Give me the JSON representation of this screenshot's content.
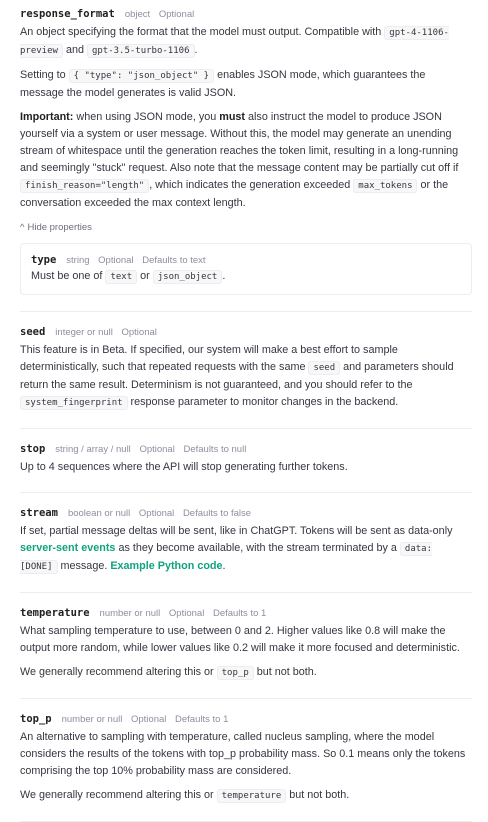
{
  "params": {
    "response_format": {
      "name": "response_format",
      "type": "object",
      "optional": "Optional",
      "d1_a": "An object specifying the format that the model must output. Compatible with",
      "d1_code1": "gpt-4-1106-preview",
      "d1_and": "and",
      "d1_code2": "gpt-3.5-turbo-1106",
      "d1_end": ".",
      "d2_a": "Setting to",
      "d2_code": "{ \"type\": \"json_object\" }",
      "d2_b": "enables JSON mode, which guarantees the message the model generates is valid JSON.",
      "d3_bold1": "Important:",
      "d3_a": "when using JSON mode, you",
      "d3_bold2": "must",
      "d3_b": "also instruct the model to produce JSON yourself via a system or user message. Without this, the model may generate an unending stream of whitespace until the generation reaches the token limit, resulting in a long-running and seemingly \"stuck\" request. Also note that the message content may be partially cut off if",
      "d3_code1": "finish_reason=\"length\"",
      "d3_c": ", which indicates the generation exceeded",
      "d3_code2": "max_tokens",
      "d3_d": "or the conversation exceeded the max context length.",
      "toggle_icon": "^",
      "toggle_label": "Hide properties",
      "child": {
        "name": "type",
        "type": "string",
        "optional": "Optional",
        "default": "Defaults to text",
        "d_a": "Must be one of",
        "code1": "text",
        "or": "or",
        "code2": "json_object",
        "end": "."
      }
    },
    "seed": {
      "name": "seed",
      "type": "integer or null",
      "optional": "Optional",
      "d_a": "This feature is in Beta. If specified, our system will make a best effort to sample deterministically, such that repeated requests with the same",
      "code1": "seed",
      "d_b": "and parameters should return the same result. Determinism is not guaranteed, and you should refer to the",
      "code2": "system_fingerprint",
      "d_c": "response parameter to monitor changes in the backend."
    },
    "stop": {
      "name": "stop",
      "type": "string / array / null",
      "optional": "Optional",
      "default": "Defaults to null",
      "desc": "Up to 4 sequences where the API will stop generating further tokens."
    },
    "stream": {
      "name": "stream",
      "type": "boolean or null",
      "optional": "Optional",
      "default": "Defaults to false",
      "d_a": "If set, partial message deltas will be sent, like in ChatGPT. Tokens will be sent as data-only",
      "link1": "server-sent events",
      "d_b": "as they become available, with the stream terminated by a",
      "code": "data: [DONE]",
      "d_c": "message.",
      "link2": "Example Python code",
      "d_end": "."
    },
    "temperature": {
      "name": "temperature",
      "type": "number or null",
      "optional": "Optional",
      "default": "Defaults to 1",
      "desc": "What sampling temperature to use, between 0 and 2. Higher values like 0.8 will make the output more random, while lower values like 0.2 will make it more focused and deterministic.",
      "r_a": "We generally recommend altering this or",
      "r_code": "top_p",
      "r_b": "but not both."
    },
    "top_p": {
      "name": "top_p",
      "type": "number or null",
      "optional": "Optional",
      "default": "Defaults to 1",
      "desc": "An alternative to sampling with temperature, called nucleus sampling, where the model considers the results of the tokens with top_p probability mass. So 0.1 means only the tokens comprising the top 10% probability mass are considered.",
      "r_a": "We generally recommend altering this or",
      "r_code": "temperature",
      "r_b": "but not both."
    }
  }
}
